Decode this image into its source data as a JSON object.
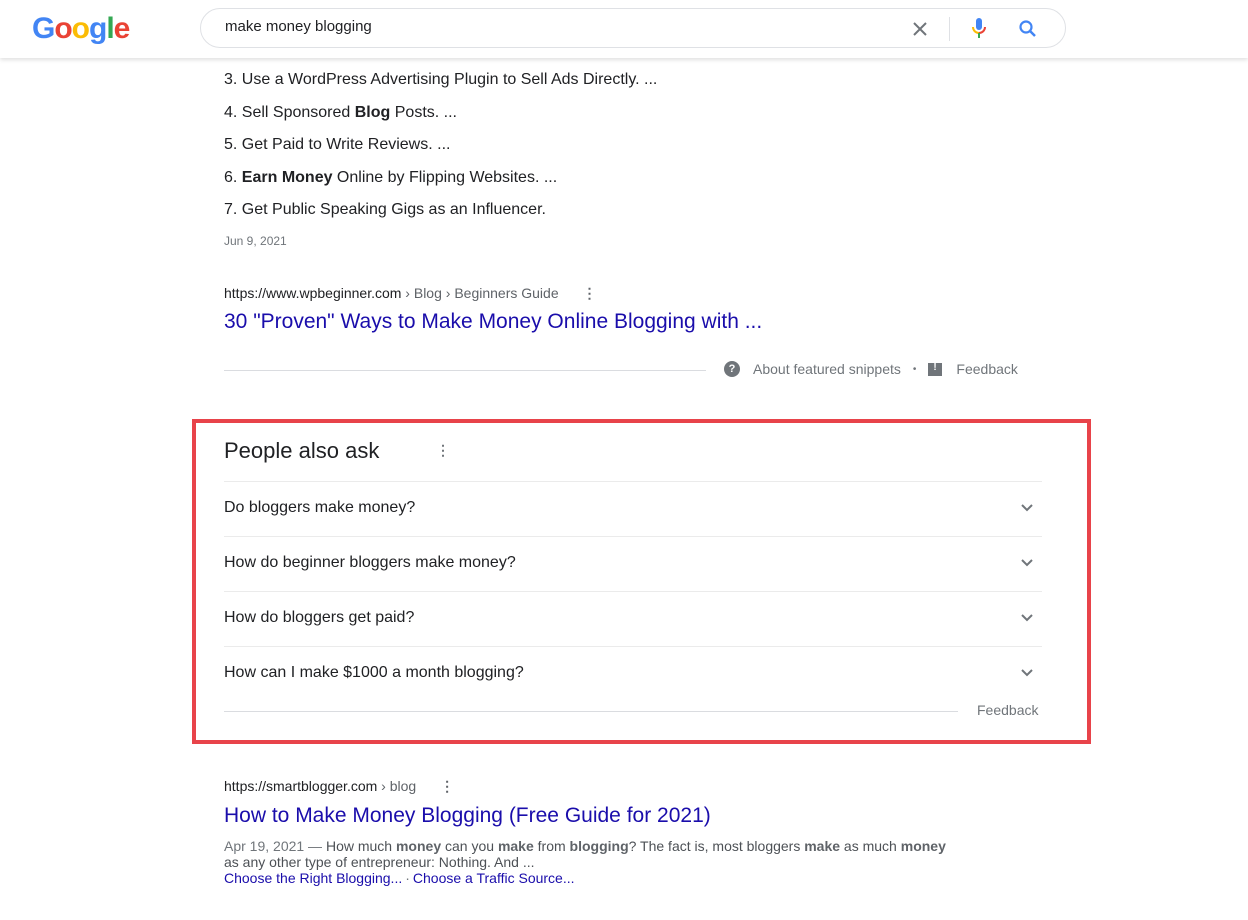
{
  "header": {
    "logo_letters": [
      {
        "char": "G",
        "color": "#4285f4"
      },
      {
        "char": "o",
        "color": "#ea4335"
      },
      {
        "char": "o",
        "color": "#fbbc05"
      },
      {
        "char": "g",
        "color": "#4285f4"
      },
      {
        "char": "l",
        "color": "#34a853"
      },
      {
        "char": "e",
        "color": "#ea4335"
      }
    ],
    "search_query": "make money blogging",
    "icons": [
      "clear-icon",
      "mic-icon",
      "search-icon"
    ]
  },
  "featured_snippet": {
    "list_items": [
      {
        "num": "3.",
        "before": " Use a WordPress Advertising Plugin to Sell Ads Directly. ...",
        "bold": "",
        "after": ""
      },
      {
        "num": "4.",
        "before": " Sell Sponsored ",
        "bold": "Blog",
        "after": " Posts. ..."
      },
      {
        "num": "5.",
        "before": " Get Paid to Write Reviews. ...",
        "bold": "",
        "after": ""
      },
      {
        "num": "6.",
        "before": " ",
        "bold": "Earn Money",
        "after": " Online by Flipping Websites. ..."
      },
      {
        "num": "7.",
        "before": " Get Public Speaking Gigs as an Influencer.",
        "bold": "",
        "after": ""
      }
    ],
    "date": "Jun 9, 2021",
    "source": {
      "url": "https://www.wpbeginner.com",
      "breadcrumb": " › Blog › Beginners Guide",
      "more_icon": "⋮",
      "title": "30 \"Proven\" Ways to Make Money Online Blogging with ..."
    },
    "footer": {
      "help_icon": "?",
      "about_label": "About featured snippets",
      "separator": "•",
      "feedback_label": "Feedback"
    }
  },
  "people_also_ask": {
    "title": "People also ask",
    "more_icon": "⋮",
    "questions": [
      "Do bloggers make money?",
      "How do beginner bloggers make money?",
      "How do bloggers get paid?",
      "How can I make $1000 a month blogging?"
    ],
    "feedback_label": "Feedback",
    "highlight_color": "#e8434a"
  },
  "result2": {
    "url": "https://smartblogger.com",
    "breadcrumb": " › blog",
    "more_icon": "⋮",
    "title": "How to Make Money Blogging (Free Guide for 2021)",
    "date": "Apr 19, 2021",
    "dash": " — ",
    "description_parts": [
      {
        "t": "How much ",
        "b": false
      },
      {
        "t": "money",
        "b": true
      },
      {
        "t": " can you ",
        "b": false
      },
      {
        "t": "make",
        "b": true
      },
      {
        "t": " from ",
        "b": false
      },
      {
        "t": "blogging",
        "b": true
      },
      {
        "t": "? The fact is, most bloggers ",
        "b": false
      },
      {
        "t": "make",
        "b": true
      },
      {
        "t": " as much ",
        "b": false
      },
      {
        "t": "money",
        "b": true
      },
      {
        "t": " as any other type of entrepreneur: Nothing. And ...",
        "b": false
      }
    ],
    "sitelinks": [
      "Choose the Right Blogging...",
      "Choose a Traffic Source..."
    ],
    "sitelink_separator": "·"
  },
  "colors": {
    "link": "#1a0dab",
    "text": "#202124",
    "muted": "#70757a"
  }
}
